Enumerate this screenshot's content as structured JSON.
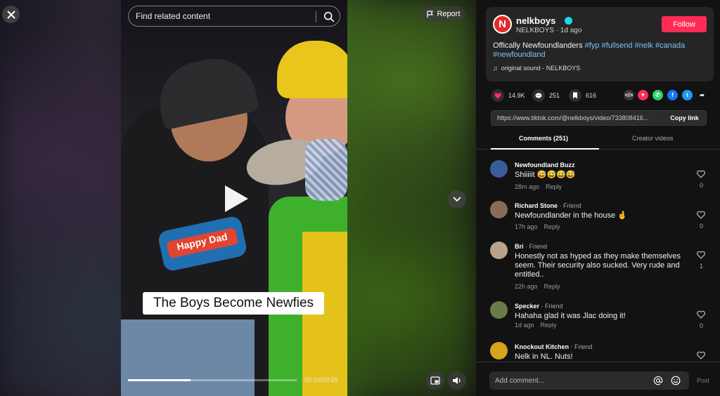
{
  "search": {
    "placeholder": "Find related content"
  },
  "report": {
    "label": "Report"
  },
  "video": {
    "caption": "The Boys Become Newfies",
    "shirt_logo_text": "Happy Dad",
    "time": "00:10/00:29",
    "progress": 0.37
  },
  "author": {
    "avatar_letter": "N",
    "name": "nelkboys",
    "meta": "NELKBOYS · 1d ago",
    "follow_label": "Follow"
  },
  "description": {
    "text": "Offically Newfoundlanders ",
    "tags": [
      "#fyp",
      "#fullsend",
      "#nelk",
      "#canada",
      "#newfoundland"
    ],
    "sound": "original sound - NELKBOYS"
  },
  "stats": {
    "likes": "14.9K",
    "comments": "251",
    "saves": "616"
  },
  "share_icons": [
    {
      "name": "embed-icon",
      "color": "#3a3a3a",
      "glyph": "</>"
    },
    {
      "name": "send-to-friends-icon",
      "color": "#fe2c55",
      "glyph": "▼"
    },
    {
      "name": "whatsapp-icon",
      "color": "#25d366",
      "glyph": "✆"
    },
    {
      "name": "facebook-icon",
      "color": "#1877f2",
      "glyph": "f"
    },
    {
      "name": "twitter-icon",
      "color": "#1d9bf0",
      "glyph": "t"
    },
    {
      "name": "share-arrow-icon",
      "color": "#121212",
      "glyph": "➦"
    }
  ],
  "link": {
    "url": "https://www.tiktok.com/@nelkboys/video/733808416...",
    "copy_label": "Copy link"
  },
  "tabs": {
    "comments": "Comments (251)",
    "creator": "Creator videos"
  },
  "comments": [
    {
      "name": "Newfoundland Buzz",
      "friend": "",
      "text": "Shiiiiit 😅😅😅😅",
      "time": "28m ago",
      "reply": "Reply",
      "likes": "0",
      "avatar_color": "#3b5c9a"
    },
    {
      "name": "Richard Stone",
      "friend": " · Friend",
      "text": "Newfoundlander in the house 🤞",
      "time": "17h ago",
      "reply": "Reply",
      "likes": "0",
      "avatar_color": "#8a6b5a"
    },
    {
      "name": "Bri",
      "friend": " · Friend",
      "text": "Honestly not as hyped as they make themselves seem. Their security also sucked. Very rude and entitled..",
      "time": "22h ago",
      "reply": "Reply",
      "likes": "1",
      "avatar_color": "#b9a38c"
    },
    {
      "name": "Specker",
      "friend": " · Friend",
      "text": "Hahaha glad it was Jlac doing it!",
      "time": "1d ago",
      "reply": "Reply",
      "likes": "0",
      "avatar_color": "#6b7a4a"
    },
    {
      "name": "Knockout Kitchen",
      "friend": " · Friend",
      "text": "Nelk in NL. Nuts!",
      "time": "",
      "reply": "",
      "likes": "",
      "avatar_color": "#d7a21d"
    }
  ],
  "composer": {
    "placeholder": "Add comment...",
    "post_label": "Post"
  }
}
